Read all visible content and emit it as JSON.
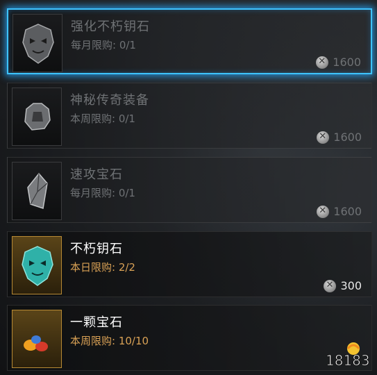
{
  "items": [
    {
      "title": "强化不朽钥石",
      "limit": "每月限购: 0/1",
      "price": "1600",
      "state": "selected-disabled",
      "icon": "mask-key-icon"
    },
    {
      "title": "神秘传奇装备",
      "limit": "本周限购: 0/1",
      "price": "1600",
      "state": "disabled",
      "icon": "armor-icon"
    },
    {
      "title": "速攻宝石",
      "limit": "每月限购: 0/1",
      "price": "1600",
      "state": "disabled",
      "icon": "crystal-shard-icon"
    },
    {
      "title": "不朽钥石",
      "limit": "本日限购: 2/2",
      "price": "300",
      "state": "active",
      "icon": "teal-mask-key-icon"
    },
    {
      "title": "一颗宝石",
      "limit": "本周限购: 10/10",
      "price": "",
      "state": "active",
      "icon": "gems-icon"
    }
  ],
  "watermark": {
    "text": "18183"
  },
  "colors": {
    "highlight": "#3ec3ff",
    "limit_text": "#d9a155",
    "icon_frame_gold": "#b88a34"
  }
}
